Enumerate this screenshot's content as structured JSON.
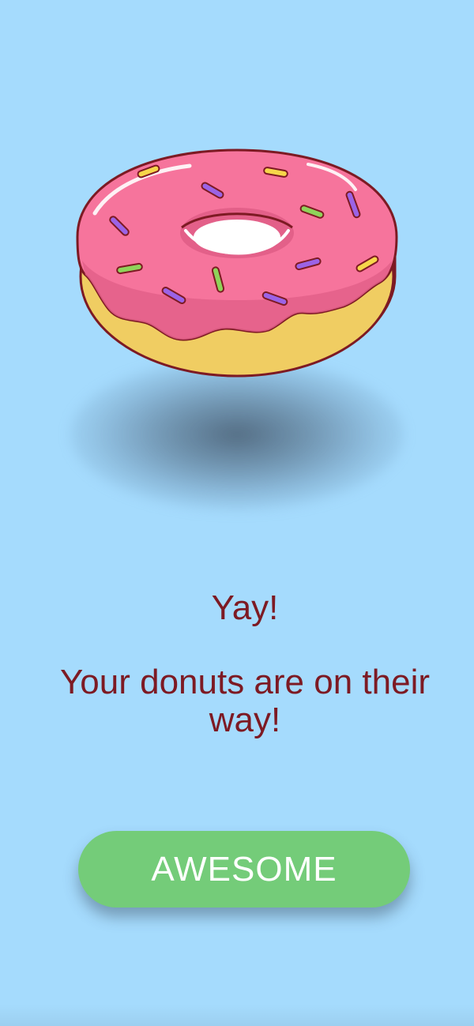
{
  "screen": {
    "background_color": "#a5dbfd"
  },
  "illustration": {
    "icon": "donut-illustration",
    "glaze_color": "#f6749c",
    "dough_color": "#f0cd62",
    "outline_color": "#7d1a23",
    "sprinkle_colors": [
      "#f6d64a",
      "#9b63e6",
      "#8fd35a"
    ]
  },
  "message": {
    "title": "Yay!",
    "subtitle": "Your donuts are on their way!",
    "text_color": "#7d1a23"
  },
  "action": {
    "button_label": "AWESOME",
    "button_color": "#74cc79"
  }
}
